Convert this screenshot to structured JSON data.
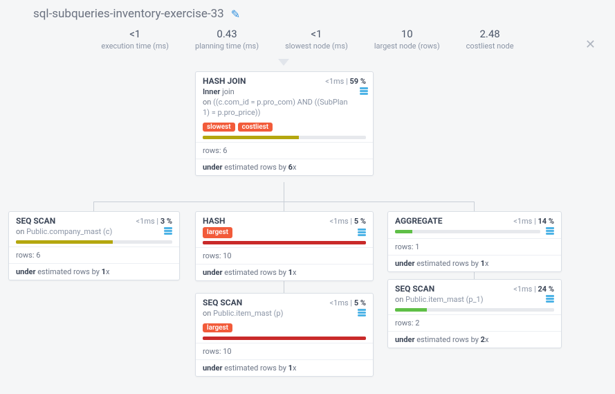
{
  "title": "sql-subqueries-inventory-exercise-33",
  "metrics": {
    "exec_time": {
      "value": "<1",
      "label": "execution time (ms)"
    },
    "plan_time": {
      "value": "0.43",
      "label": "planning time (ms)"
    },
    "slowest": {
      "value": "<1",
      "label": "slowest node (ms)"
    },
    "largest": {
      "value": "10",
      "label": "largest node (rows)"
    },
    "costliest": {
      "value": "2.48",
      "label": "costliest node"
    }
  },
  "colors": {
    "olive": "#b4a70f",
    "red": "#c92a2a",
    "green": "#5fbf47"
  },
  "nodes": {
    "hashjoin": {
      "name": "HASH JOIN",
      "time": "<1ms",
      "pct": "59 %",
      "sub_lead": "Inner",
      "sub_kw1": "join",
      "sub_on": "on",
      "sub_cond": "((c.com_id = p.pro_com) AND ((SubPlan 1) = p.pro_price))",
      "badges": [
        "slowest",
        "costliest"
      ],
      "bar_pct": 59,
      "bar_color": "olive",
      "rows": "rows: 6",
      "est_prefix": "under",
      "est_mid": " estimated rows by ",
      "est_factor": "6",
      "est_suffix": "x"
    },
    "seqscan_company": {
      "name": "SEQ SCAN",
      "time": "<1ms",
      "pct": "3 %",
      "sub_on": "on",
      "sub_target": "Public.company_mast (c)",
      "bar_pct": 62,
      "bar_color": "olive",
      "rows": "rows: 6",
      "est_prefix": "under",
      "est_mid": " estimated rows by ",
      "est_factor": "1",
      "est_suffix": "x"
    },
    "hash": {
      "name": "HASH",
      "time": "<1ms",
      "pct": "5 %",
      "badges": [
        "largest"
      ],
      "bar_pct": 100,
      "bar_color": "red",
      "rows": "rows: 10",
      "est_prefix": "under",
      "est_mid": " estimated rows by ",
      "est_factor": "1",
      "est_suffix": "x"
    },
    "seqscan_item": {
      "name": "SEQ SCAN",
      "time": "<1ms",
      "pct": "5 %",
      "sub_on": "on",
      "sub_target": "Public.item_mast (p)",
      "badges": [
        "largest"
      ],
      "bar_pct": 100,
      "bar_color": "red",
      "rows": "rows: 10",
      "est_prefix": "under",
      "est_mid": " estimated rows by ",
      "est_factor": "1",
      "est_suffix": "x"
    },
    "aggregate": {
      "name": "AGGREGATE",
      "time": "<1ms",
      "pct": "14 %",
      "bar_pct": 12,
      "bar_color": "green",
      "rows": "rows: 1",
      "est_prefix": "under",
      "est_mid": " estimated rows by ",
      "est_factor": "1",
      "est_suffix": "x"
    },
    "seqscan_item_p1": {
      "name": "SEQ SCAN",
      "time": "<1ms",
      "pct": "24 %",
      "sub_on": "on",
      "sub_target": "Public.item_mast (p_1)",
      "bar_pct": 20,
      "bar_color": "green",
      "rows": "rows: 2",
      "est_prefix": "under",
      "est_mid": " estimated rows by ",
      "est_factor": "2",
      "est_suffix": "x"
    }
  }
}
